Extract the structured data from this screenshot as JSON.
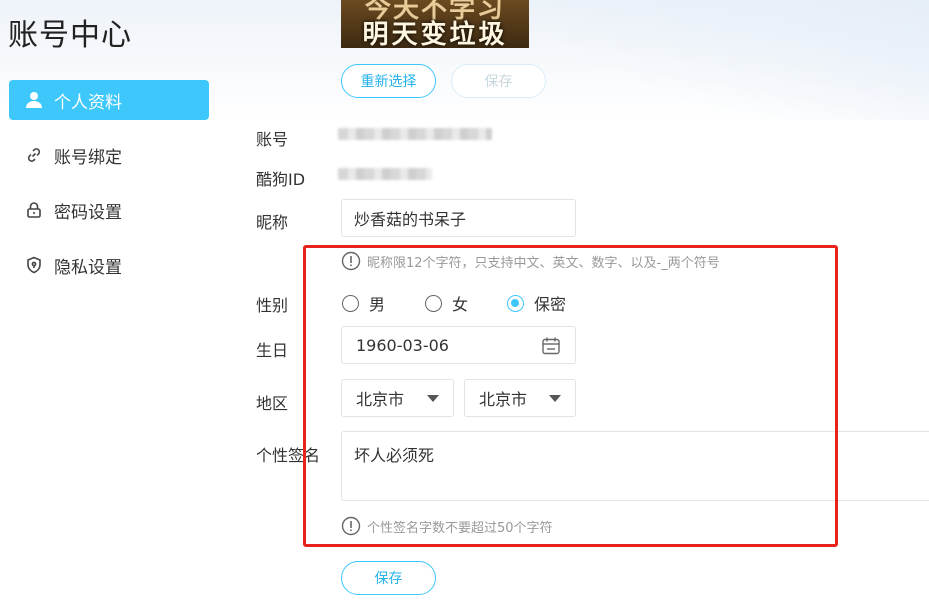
{
  "page": {
    "title": "账号中心"
  },
  "sidebar": {
    "items": [
      {
        "label": "个人资料",
        "icon": "user-icon",
        "active": true
      },
      {
        "label": "账号绑定",
        "icon": "link-icon",
        "active": false
      },
      {
        "label": "密码设置",
        "icon": "lock-icon",
        "active": false
      },
      {
        "label": "隐私设置",
        "icon": "shield-icon",
        "active": false
      }
    ]
  },
  "avatar": {
    "line1": "今天不学习",
    "line2": "明天变垃圾"
  },
  "avatar_actions": {
    "reselect_label": "重新选择",
    "save_label": "保存"
  },
  "profile": {
    "account_label": "账号",
    "kugou_id_label": "酷狗ID",
    "nickname_label": "昵称",
    "nickname_value": "炒香菇的书呆子",
    "nickname_hint": "昵称限12个字符，只支持中文、英文、数字、以及-_两个符号",
    "gender_label": "性别",
    "gender_options": [
      "男",
      "女",
      "保密"
    ],
    "gender_selected": "保密",
    "birthday_label": "生日",
    "birthday_value": "1960-03-06",
    "region_label": "地区",
    "province_value": "北京市",
    "city_value": "北京市",
    "signature_label": "个性签名",
    "signature_value": "坏人必须死",
    "signature_hint": "个性签名字数不要超过50个字符",
    "save_label": "保存"
  },
  "colors": {
    "accent": "#3ec7fb",
    "highlight_border": "#e8231b"
  }
}
